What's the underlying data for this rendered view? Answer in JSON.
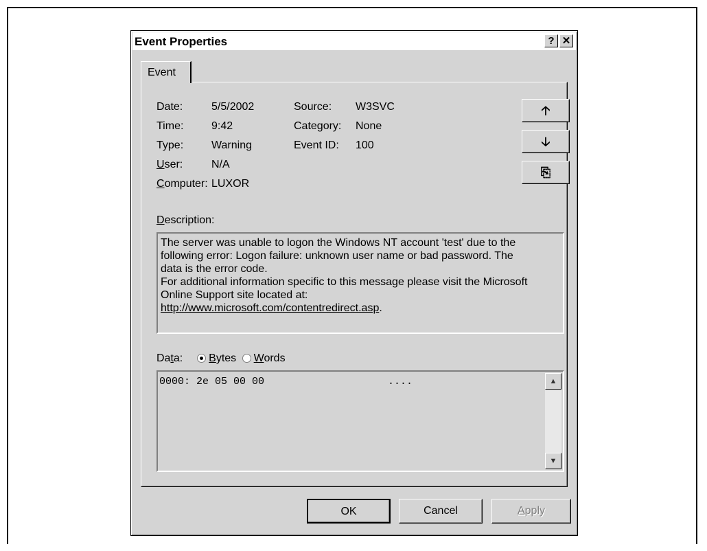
{
  "window": {
    "title": "Event Properties",
    "help_glyph": "?",
    "close_glyph": "✕"
  },
  "tabs": [
    {
      "label": "Event"
    }
  ],
  "fields": {
    "date_label": "Date:",
    "date_value": "5/5/2002",
    "time_label": "Time:",
    "time_value": "9:42",
    "type_label": "Type:",
    "type_value": "Warning",
    "user_label_u": "U",
    "user_label_rest": "ser:",
    "user_value": "N/A",
    "computer_label_u": "C",
    "computer_label_rest": "omputer:",
    "computer_value": "LUXOR",
    "source_label": "Source:",
    "source_value": "W3SVC",
    "category_label": "Category:",
    "category_value": "None",
    "event_id_label": "Event ID:",
    "event_id_value": "100"
  },
  "nav_buttons": {
    "up": "🡡",
    "down": "🡣",
    "copy": "⎘"
  },
  "icons": {
    "up": "arrow-up-icon",
    "down": "arrow-down-icon",
    "copy": "copy-icon"
  },
  "description": {
    "label_u": "D",
    "label_rest": "escription:",
    "lines": [
      "The server was unable to logon the Windows NT account 'test' due to the",
      "following error: Logon failure: unknown user name or bad password.  The",
      "data is the error code.",
      "For additional information specific to this message please visit the Microsoft",
      "Online Support site located at:"
    ],
    "link": "http://www.microsoft.com/contentredirect.asp",
    "link_suffix": "."
  },
  "data_section": {
    "label_pre": "Da",
    "label_u": "t",
    "label_post": "a:",
    "bytes_u": "B",
    "bytes_rest": "ytes",
    "words_u": "W",
    "words_rest": "ords",
    "selected": "Bytes",
    "line": "0000: 2e 05 00 00                    ....",
    "scroll_up": "▲",
    "scroll_down": "▼"
  },
  "buttons": {
    "ok": "OK",
    "cancel": "Cancel",
    "apply_u": "A",
    "apply_rest": "pply"
  }
}
